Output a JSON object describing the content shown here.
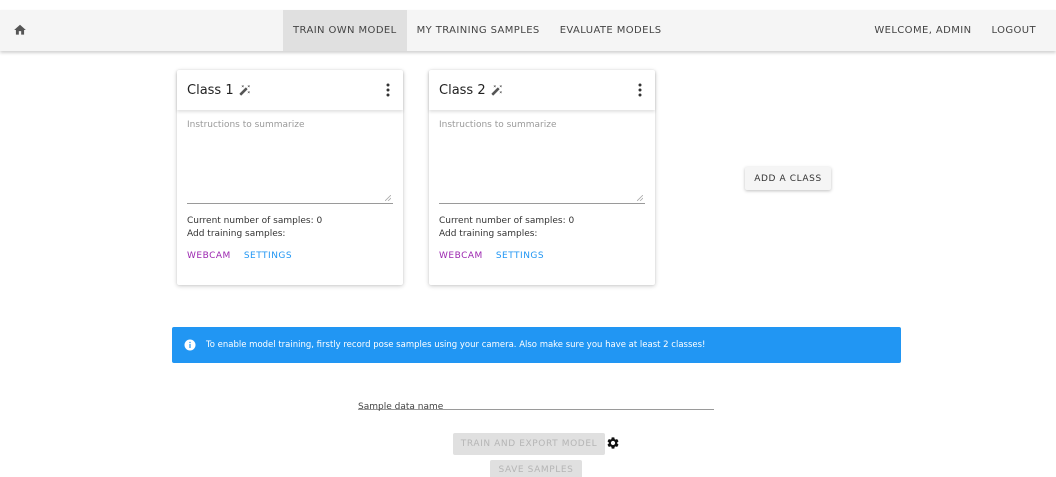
{
  "nav": {
    "home_icon": "home-icon",
    "tabs": [
      {
        "label": "TRAIN OWN MODEL",
        "active": true
      },
      {
        "label": "MY TRAINING SAMPLES",
        "active": false
      },
      {
        "label": "EVALUATE MODELS",
        "active": false
      }
    ],
    "welcome": "WELCOME, ADMIN",
    "logout": "LOGOUT"
  },
  "classes": [
    {
      "name": "Class 1",
      "placeholder": "Instructions to summarize",
      "samples_text": "Current number of samples: 0",
      "add_text": "Add training samples:",
      "webcam_label": "WEBCAM",
      "settings_label": "SETTINGS"
    },
    {
      "name": "Class 2",
      "placeholder": "Instructions to summarize",
      "samples_text": "Current number of samples: 0",
      "add_text": "Add training samples:",
      "webcam_label": "WEBCAM",
      "settings_label": "SETTINGS"
    }
  ],
  "add_class_label": "ADD A CLASS",
  "alert": {
    "text": "To enable model training, firstly record pose samples using your camera. Also make sure you have at least 2 classes!",
    "color": "#2196f3"
  },
  "sample_input": {
    "placeholder": "Sample data name",
    "value": ""
  },
  "train_button_label": "TRAIN AND EXPORT MODEL",
  "save_button_label": "SAVE SAMPLES",
  "colors": {
    "webcam": "#9c27b0",
    "settings": "#2196f3",
    "nav_bg": "#f5f5f5"
  }
}
